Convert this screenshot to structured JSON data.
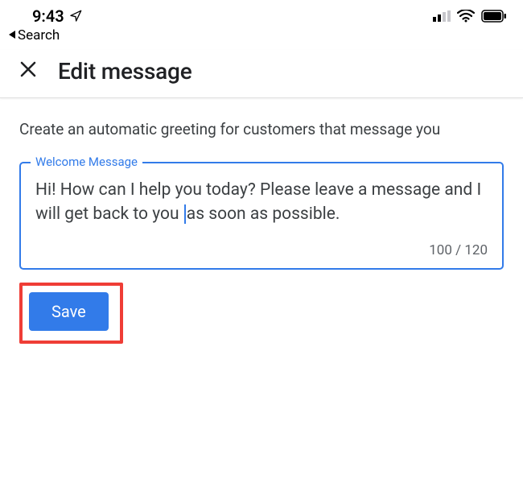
{
  "statusbar": {
    "time": "9:43",
    "back_label": "Search"
  },
  "header": {
    "title": "Edit message"
  },
  "content": {
    "subtitle": "Create an automatic greeting for customers that message you",
    "field_label": "Welcome Message",
    "message_before": "Hi! How can I help you today? Please leave a message and I will get back to you ",
    "message_after": "as soon as possible.",
    "char_count": "100 / 120"
  },
  "actions": {
    "save_label": "Save"
  }
}
